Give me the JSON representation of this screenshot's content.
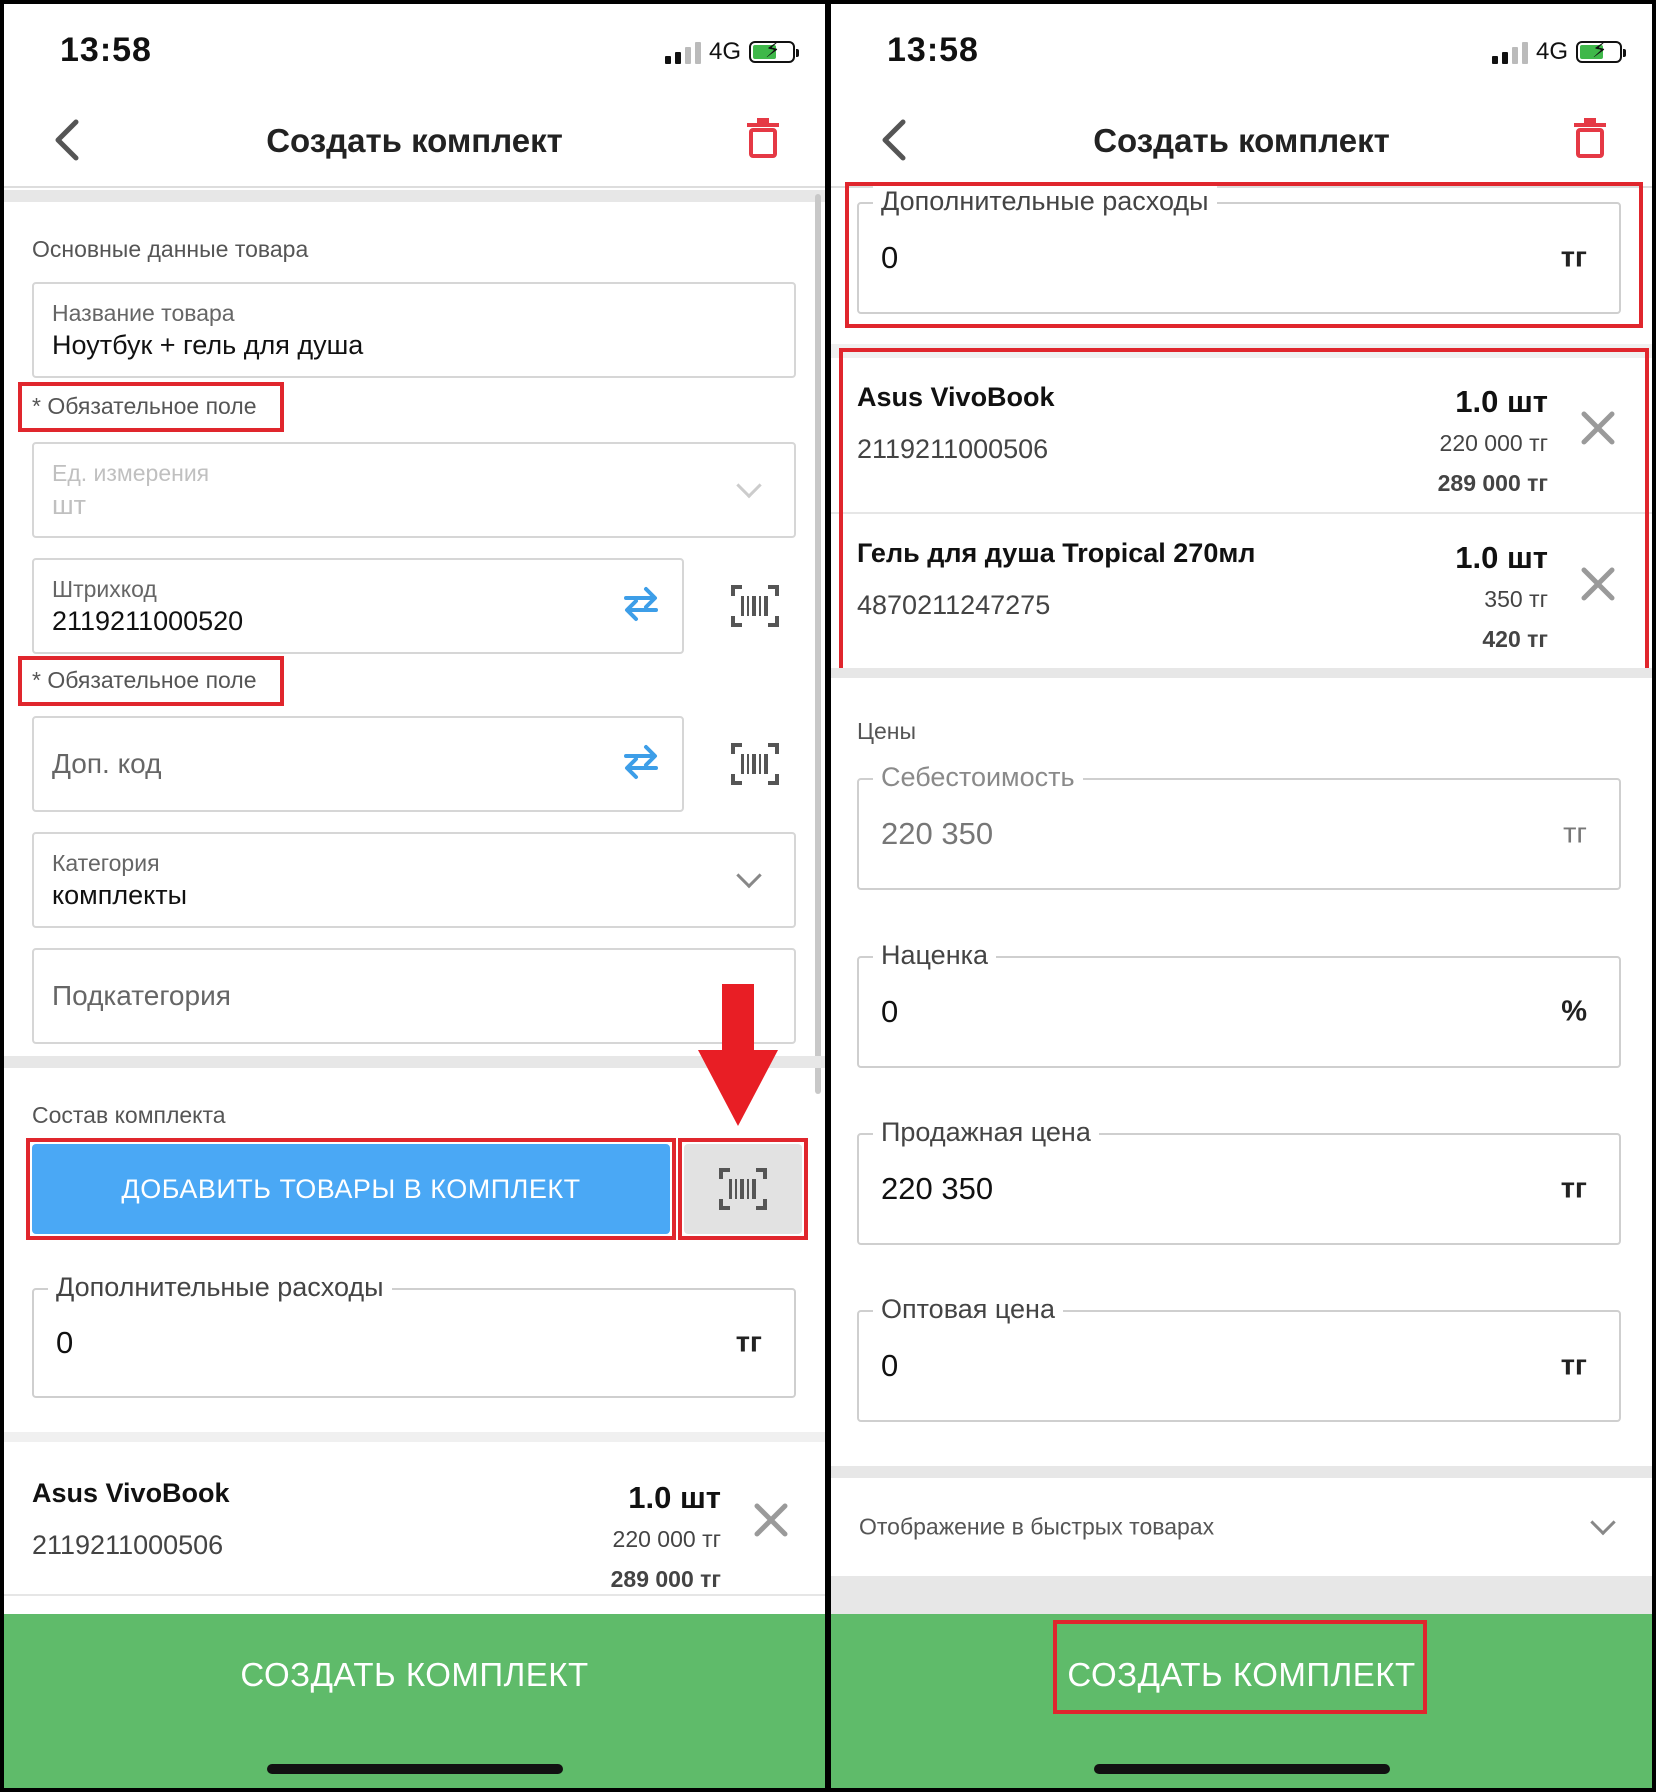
{
  "status": {
    "time": "13:58",
    "network": "4G"
  },
  "nav": {
    "title": "Создать комплект"
  },
  "left": {
    "section_main": "Основные данные товара",
    "name_field": {
      "label": "Название товара",
      "value": "Ноутбук + гель для душа"
    },
    "required_hint": "* Обязательное поле",
    "unit_field": {
      "label": "Ед. измерения",
      "value": "шт"
    },
    "barcode_field": {
      "label": "Штрихкод",
      "value": "2119211000520"
    },
    "addcode_field": {
      "placeholder": "Доп. код"
    },
    "category_field": {
      "label": "Категория",
      "value": "комплекты"
    },
    "subcategory_field": {
      "placeholder": "Подкатегория"
    },
    "section_kit": "Состав комплекта",
    "add_button": "ДОБАВИТЬ ТОВАРЫ В КОМПЛЕКТ",
    "extra_costs": {
      "label": "Дополнительные расходы",
      "value": "0",
      "unit": "тг"
    },
    "items": [
      {
        "name": "Asus VivoBook",
        "code": "2119211000506",
        "qty": "1.0 шт",
        "cost": "220 000 тг",
        "price": "289 000 тг"
      }
    ],
    "footer_button": "СОЗДАТЬ КОМПЛЕКТ"
  },
  "right": {
    "extra_costs": {
      "label": "Дополнительные расходы",
      "value": "0",
      "unit": "тг"
    },
    "items": [
      {
        "name": "Asus VivoBook",
        "code": "2119211000506",
        "qty": "1.0 шт",
        "cost": "220 000 тг",
        "price": "289 000 тг"
      },
      {
        "name": "Гель для душа Tropical 270мл",
        "code": "4870211247275",
        "qty": "1.0 шт",
        "cost": "350 тг",
        "price": "420 тг"
      }
    ],
    "section_prices": "Цены",
    "cost_price": {
      "label": "Себестоимость",
      "value": "220 350",
      "unit": "тг"
    },
    "markup": {
      "label": "Наценка",
      "value": "0",
      "unit": "%"
    },
    "sale_price": {
      "label": "Продажная цена",
      "value": "220 350",
      "unit": "тг"
    },
    "wholesale_price": {
      "label": "Оптовая цена",
      "value": "0",
      "unit": "тг"
    },
    "quick_display": "Отображение в быстрых товарах",
    "footer_button": "СОЗДАТЬ КОМПЛЕКТ"
  },
  "colors": {
    "accent_blue": "#4aa8f5",
    "create_green": "#5fbb6a",
    "highlight_red": "#e0262d",
    "arrow_red": "#e81e25",
    "trash_red": "#e53945"
  },
  "icons": [
    "back-chevron-icon",
    "trash-icon",
    "swap-icon",
    "barcode-scan-icon",
    "close-icon",
    "chevron-down-icon",
    "down-arrow-icon"
  ]
}
